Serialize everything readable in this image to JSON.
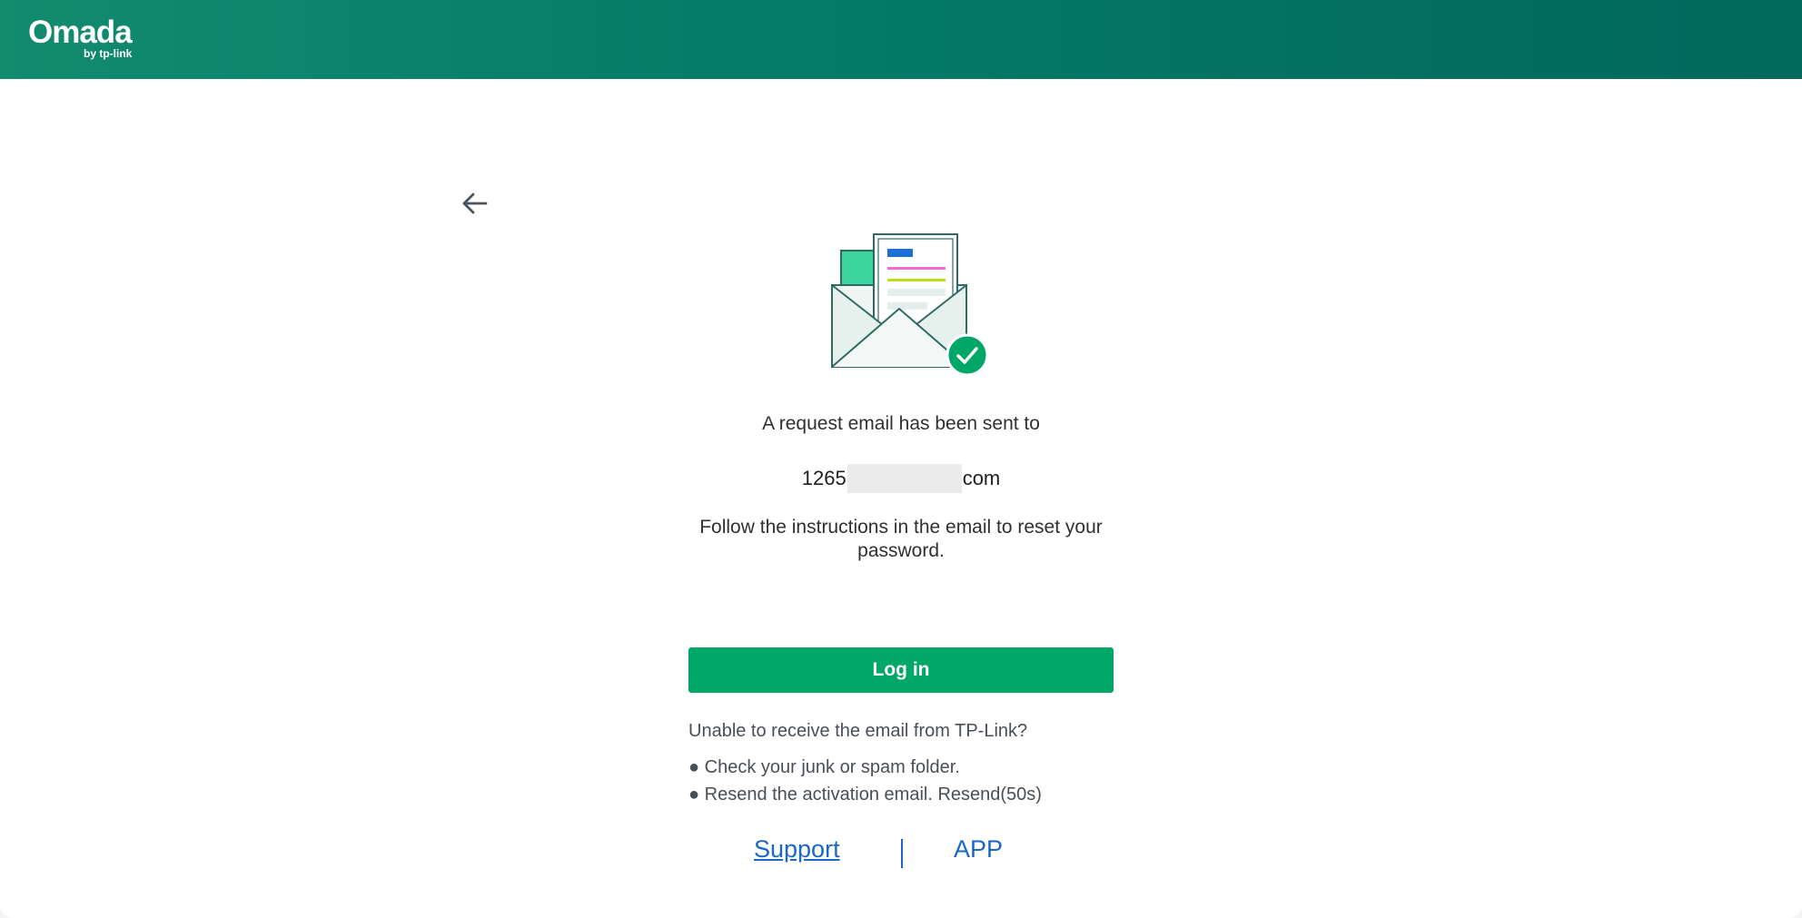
{
  "header": {
    "logo_text": "Omada",
    "logo_subtext": "by tp-link"
  },
  "icons": {
    "back": "arrow-left-icon",
    "illustration": "envelope-check-illustration"
  },
  "message": {
    "line1": "A request email has been sent to",
    "email_prefix": "1265",
    "email_suffix": "com",
    "instructions": "Follow the instructions in the email to reset your password."
  },
  "actions": {
    "login_label": "Log in"
  },
  "help": {
    "question": "Unable to receive the email from TP-Link?",
    "tip1": "● Check your junk or spam folder.",
    "tip2": "● Resend the activation email. Resend(50s)"
  },
  "footer_links": {
    "support": "Support",
    "app": "APP"
  },
  "colors": {
    "header_start": "#138b6f",
    "header_end": "#02685c",
    "primary_button": "#00a766",
    "link": "#1a66c9"
  }
}
